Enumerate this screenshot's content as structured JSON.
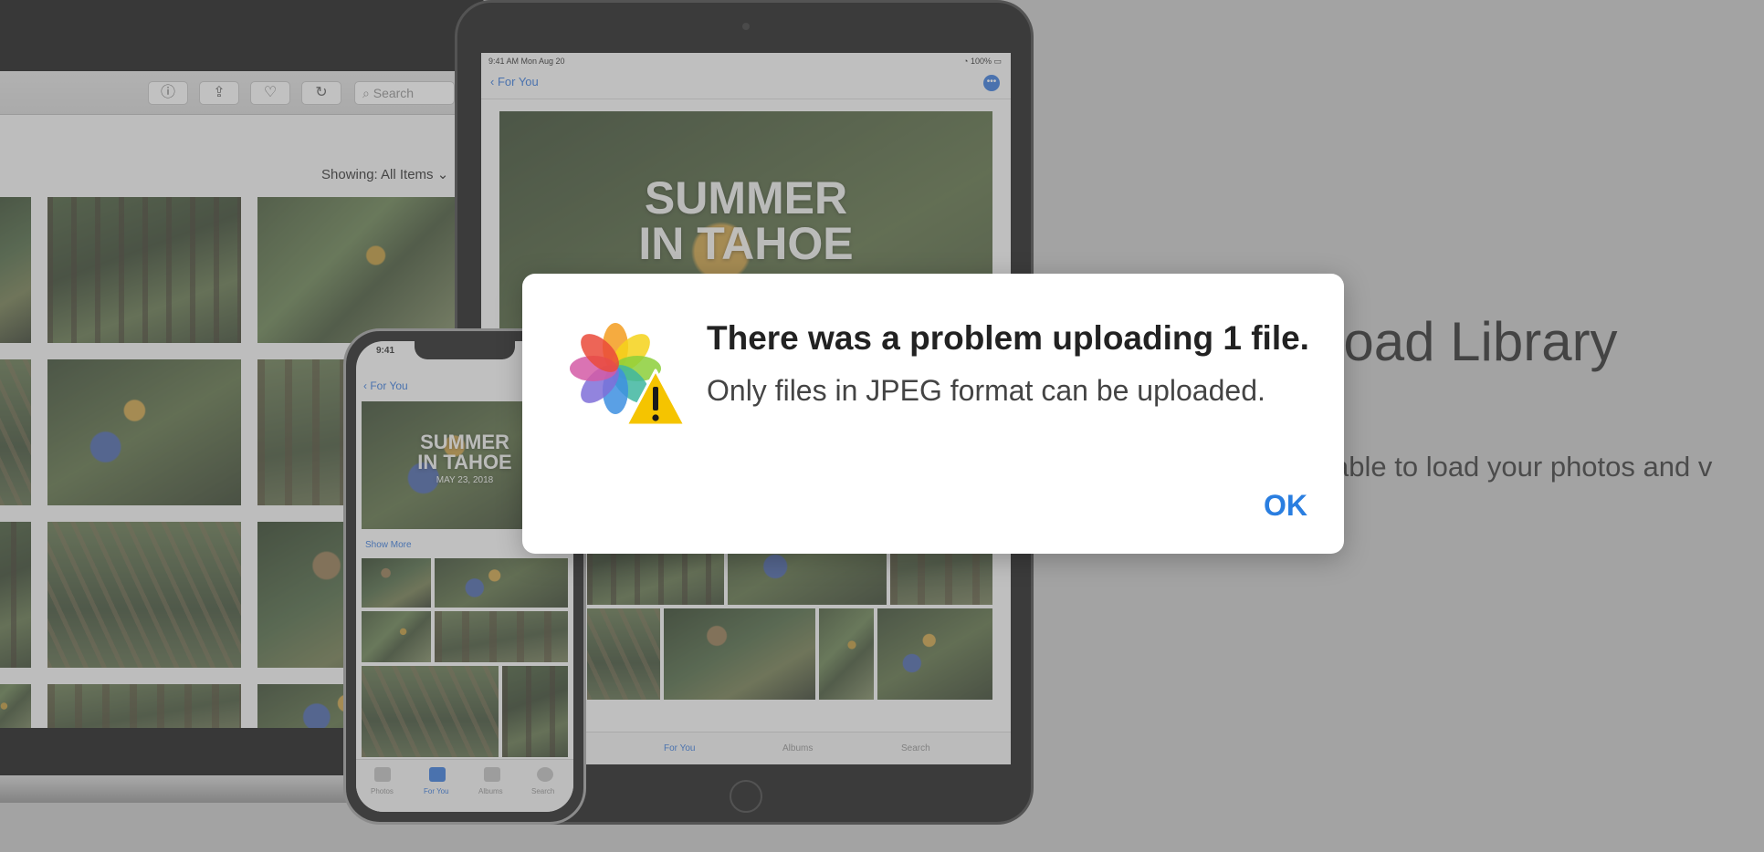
{
  "background_page": {
    "title": "Load Library",
    "body": "able to load your photos and v"
  },
  "laptop": {
    "search_placeholder": "Search",
    "showing_label": "Showing: All Items"
  },
  "ipad": {
    "status_time": "9:41 AM  Mon Aug 20",
    "status_battery": "100%",
    "back_label": "For You",
    "hero_line1": "SUMMER",
    "hero_line2": "IN TAHOE",
    "tabs": [
      "For You",
      "Albums",
      "Search"
    ]
  },
  "iphone": {
    "time": "9:41",
    "back_label": "For You",
    "hero_line1": "SUMMER",
    "hero_line2": "IN TAHOE",
    "hero_date": "MAY 23, 2018",
    "show_more": "Show More",
    "tabs": [
      "Photos",
      "For You",
      "Albums",
      "Search"
    ]
  },
  "dialog": {
    "title": "There was a problem uploading 1 file.",
    "message": "Only files in JPEG format can be uploaded.",
    "ok_label": "OK",
    "icon": "photos-app-icon-with-warning"
  },
  "colors": {
    "accent": "#2a7ee0",
    "warning": "#f5c400"
  }
}
